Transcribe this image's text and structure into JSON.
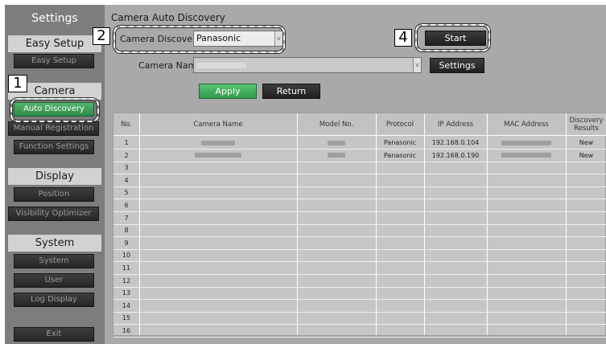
{
  "sidebar": {
    "title": "Settings",
    "sections": [
      {
        "label": "Easy Setup"
      },
      {
        "label": "Camera"
      },
      {
        "label": "Display"
      },
      {
        "label": "System"
      }
    ],
    "buttons": {
      "easy_setup": "Easy Setup",
      "auto_discovery": "Auto Discovery",
      "manual_registration": "Manual Registration",
      "function_settings": "Function Settings",
      "position": "Position",
      "visibility_optimizer": "Visibility Optimizer",
      "system": "System",
      "user": "User",
      "log_display": "Log Display",
      "exit": "Exit"
    }
  },
  "main": {
    "title": "Camera Auto Discovery",
    "camera_discovery": {
      "label": "Camera Discovery",
      "value": "Panasonic"
    },
    "camera_name": {
      "label": "Camera Name"
    },
    "buttons": {
      "start": "Start",
      "settings": "Settings",
      "apply": "Apply",
      "return": "Return"
    }
  },
  "callouts": {
    "one": "1",
    "two": "2",
    "four": "4"
  },
  "table": {
    "headers": {
      "no": "No.",
      "camera_name": "Camera Name",
      "model_no": "Model No.",
      "protocol": "Protocol",
      "ip_address": "IP Address",
      "mac_address": "MAC Address",
      "discovery_results_1": "Discovery",
      "discovery_results_2": "Results"
    },
    "rows": [
      {
        "no": "1",
        "protocol": "Panasonic",
        "ip": "192.168.0.104",
        "result": "New"
      },
      {
        "no": "2",
        "protocol": "Panasonic",
        "ip": "192.168.0.190",
        "result": "New"
      },
      {
        "no": "3"
      },
      {
        "no": "4"
      },
      {
        "no": "5"
      },
      {
        "no": "6"
      },
      {
        "no": "7"
      },
      {
        "no": "8"
      },
      {
        "no": "9"
      },
      {
        "no": "10"
      },
      {
        "no": "11"
      },
      {
        "no": "12"
      },
      {
        "no": "13"
      },
      {
        "no": "14"
      },
      {
        "no": "15"
      },
      {
        "no": "16"
      }
    ]
  }
}
